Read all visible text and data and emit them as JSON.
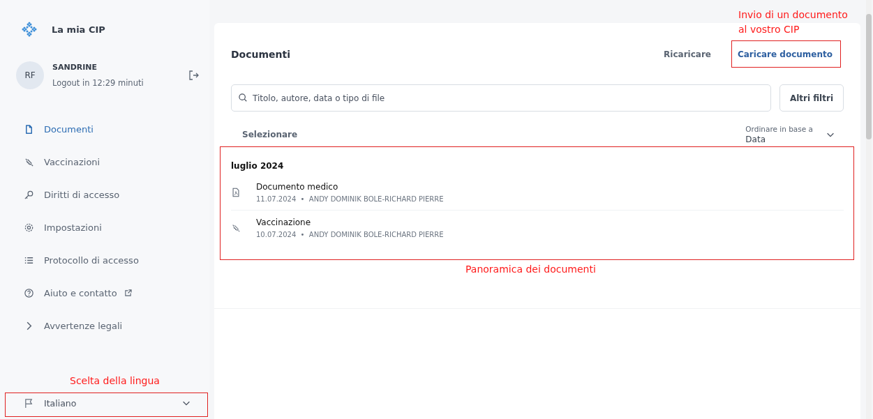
{
  "app": {
    "title": "La mia CIP"
  },
  "user": {
    "initials": "RF",
    "name": "SANDRINE",
    "session": "Logout in 12:29 minuti"
  },
  "nav": [
    {
      "kind": "document",
      "label": "Documenti",
      "selected": true,
      "external": false
    },
    {
      "kind": "vaccination",
      "label": "Vaccinazioni",
      "selected": false,
      "external": false
    },
    {
      "kind": "access",
      "label": "Diritti di accesso",
      "selected": false,
      "external": false
    },
    {
      "kind": "settings",
      "label": "Impostazioni",
      "selected": false,
      "external": false
    },
    {
      "kind": "log",
      "label": "Protocollo di accesso",
      "selected": false,
      "external": false
    },
    {
      "kind": "help",
      "label": "Aiuto e contatto",
      "selected": false,
      "external": true
    },
    {
      "kind": "legal",
      "label": "Avvertenze legali",
      "selected": false,
      "external": false
    }
  ],
  "language": {
    "value": "Italiano"
  },
  "documents": {
    "title": "Documenti",
    "reload": "Ricaricare",
    "upload": "Caricare documento",
    "search": {
      "placeholder": "Titolo, autore, data o tipo di file"
    },
    "filters": "Altri filtri",
    "select": "Selezionare",
    "sort": {
      "label": "Ordinare in base a",
      "value": "Data"
    },
    "groups": [
      {
        "title": "luglio 2024",
        "items": [
          {
            "kind": "pdf",
            "title": "Documento medico",
            "date": "11.07.2024",
            "separator": "•",
            "author": "ANDY DOMINIK BOLE-RICHARD PIERRE"
          },
          {
            "kind": "vaccination",
            "title": "Vaccinazione",
            "date": "10.07.2024",
            "separator": "•",
            "author": "ANDY DOMINIK BOLE-RICHARD PIERRE"
          }
        ]
      }
    ]
  },
  "annotations": [
    {
      "kind": "upload",
      "lines": [
        "Invio di un documento",
        "al vostro CIP"
      ]
    },
    {
      "kind": "list",
      "lines": [
        "Panoramica dei documenti"
      ]
    },
    {
      "kind": "language",
      "lines": [
        "Scelta della lingua"
      ]
    }
  ]
}
